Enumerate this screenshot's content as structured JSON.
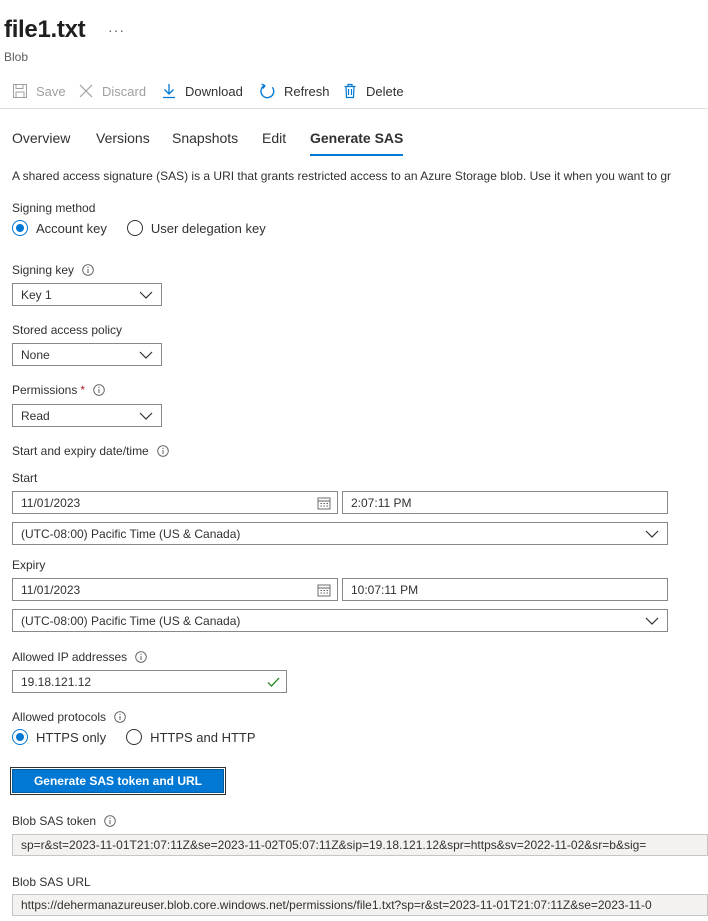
{
  "header": {
    "title": "file1.txt",
    "more": "···",
    "subtitle": "Blob"
  },
  "toolbar": {
    "save": "Save",
    "discard": "Discard",
    "download": "Download",
    "refresh": "Refresh",
    "delete": "Delete"
  },
  "tabs": {
    "overview": "Overview",
    "versions": "Versions",
    "snapshots": "Snapshots",
    "edit": "Edit",
    "generate_sas": "Generate SAS"
  },
  "description": "A shared access signature (SAS) is a URI that grants restricted access to an Azure Storage blob. Use it when you want to gr",
  "signing_method": {
    "label": "Signing method",
    "account_key": "Account key",
    "user_delegation_key": "User delegation key",
    "selected": "Account key"
  },
  "signing_key": {
    "label": "Signing key",
    "value": "Key 1"
  },
  "stored_access_policy": {
    "label": "Stored access policy",
    "value": "None"
  },
  "permissions": {
    "label": "Permissions",
    "required_mark": "*",
    "value": "Read"
  },
  "dates": {
    "section_label": "Start and expiry date/time",
    "start_label": "Start",
    "start_date": "11/01/2023",
    "start_time": "2:07:11 PM",
    "start_tz": "(UTC-08:00) Pacific Time (US & Canada)",
    "expiry_label": "Expiry",
    "expiry_date": "11/01/2023",
    "expiry_time": "10:07:11 PM",
    "expiry_tz": "(UTC-08:00) Pacific Time (US & Canada)"
  },
  "allowed_ip": {
    "label": "Allowed IP addresses",
    "value": "19.18.121.12"
  },
  "allowed_protocols": {
    "label": "Allowed protocols",
    "https_only": "HTTPS only",
    "https_and_http": "HTTPS and HTTP",
    "selected": "HTTPS only"
  },
  "generate_button": "Generate SAS token and URL",
  "sas_token": {
    "label": "Blob SAS token",
    "value": "sp=r&st=2023-11-01T21:07:11Z&se=2023-11-02T05:07:11Z&sip=19.18.121.12&spr=https&sv=2022-11-02&sr=b&sig="
  },
  "sas_url": {
    "label": "Blob SAS URL",
    "value": "https://dehermanazureuser.blob.core.windows.net/permissions/file1.txt?sp=r&st=2023-11-01T21:07:11Z&se=2023-11-0"
  },
  "colors": {
    "accent": "#0078d4",
    "success": "#107c10",
    "required": "#a4262c"
  }
}
